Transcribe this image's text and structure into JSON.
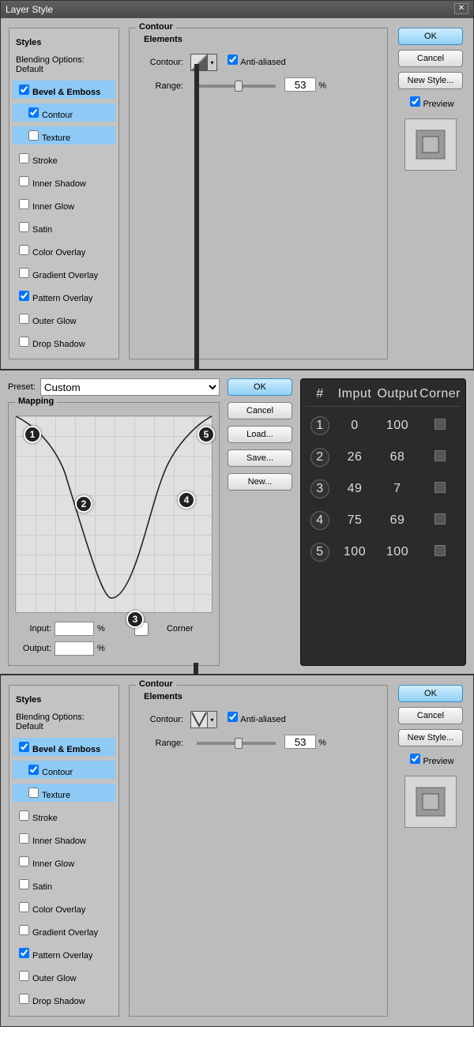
{
  "title": "Layer Style",
  "styles_list": {
    "header": "Styles",
    "blending": "Blending Options: Default",
    "items": [
      {
        "label": "Bevel & Emboss",
        "checked": true,
        "selected": true,
        "bold": true
      },
      {
        "label": "Contour",
        "checked": true,
        "selected": true,
        "bold": false,
        "sub": true
      },
      {
        "label": "Texture",
        "checked": false,
        "selected": true,
        "bold": false,
        "sub": true
      },
      {
        "label": "Stroke",
        "checked": false
      },
      {
        "label": "Inner Shadow",
        "checked": false
      },
      {
        "label": "Inner Glow",
        "checked": false
      },
      {
        "label": "Satin",
        "checked": false
      },
      {
        "label": "Color Overlay",
        "checked": false
      },
      {
        "label": "Gradient Overlay",
        "checked": false
      },
      {
        "label": "Pattern Overlay",
        "checked": true
      },
      {
        "label": "Outer Glow",
        "checked": false
      },
      {
        "label": "Drop Shadow",
        "checked": false
      }
    ]
  },
  "contour_panel": {
    "group": "Contour",
    "elements": "Elements",
    "contour_label": "Contour:",
    "antialiased": "Anti-aliased",
    "range_label": "Range:",
    "range_value": "53",
    "percent": "%"
  },
  "buttons": {
    "ok": "OK",
    "cancel": "Cancel",
    "newstyle": "New Style...",
    "preview": "Preview"
  },
  "editor": {
    "preset_label": "Preset:",
    "preset_value": "Custom",
    "mapping": "Mapping",
    "input": "Input:",
    "output": "Output:",
    "percent": "%",
    "corner": "Corner",
    "btns": {
      "ok": "OK",
      "cancel": "Cancel",
      "load": "Load...",
      "save": "Save...",
      "new": "New..."
    }
  },
  "dark_table": {
    "head": [
      "#",
      "Imput",
      "Output",
      "Corner"
    ],
    "rows": [
      {
        "n": "1",
        "in": "0",
        "out": "100"
      },
      {
        "n": "2",
        "in": "26",
        "out": "68"
      },
      {
        "n": "3",
        "in": "49",
        "out": "7"
      },
      {
        "n": "4",
        "in": "75",
        "out": "69"
      },
      {
        "n": "5",
        "in": "100",
        "out": "100"
      }
    ]
  },
  "chart_data": {
    "type": "line",
    "title": "Contour Mapping",
    "xlabel": "Input",
    "ylabel": "Output",
    "xlim": [
      0,
      100
    ],
    "ylim": [
      0,
      100
    ],
    "x": [
      0,
      26,
      49,
      75,
      100
    ],
    "y": [
      100,
      68,
      7,
      69,
      100
    ]
  }
}
